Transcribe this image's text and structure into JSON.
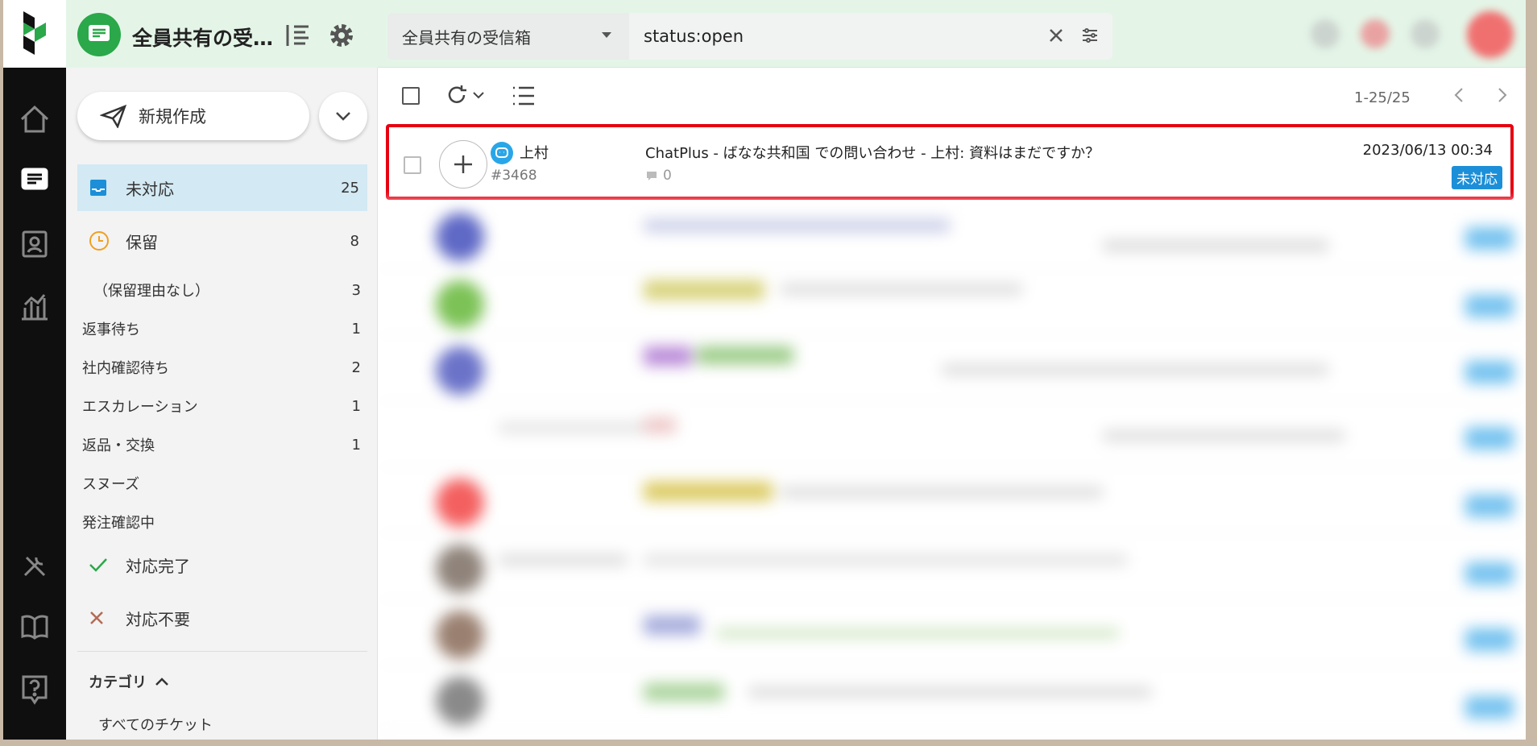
{
  "header": {
    "inbox_title": "全員共有の受…"
  },
  "sidebar": {
    "compose_label": "新規作成",
    "status_items": [
      {
        "label": "未対応",
        "count": "25"
      },
      {
        "label": "保留",
        "count": "8"
      }
    ],
    "sub_items": [
      {
        "label": "（保留理由なし）",
        "count": "3"
      },
      {
        "label": "返事待ち",
        "count": "1"
      },
      {
        "label": "社内確認待ち",
        "count": "2"
      },
      {
        "label": "エスカレーション",
        "count": "1"
      },
      {
        "label": "返品・交換",
        "count": "1"
      },
      {
        "label": "スヌーズ",
        "count": ""
      },
      {
        "label": "発注確認中",
        "count": ""
      }
    ],
    "done_items": [
      {
        "label": "対応完了"
      },
      {
        "label": "対応不要"
      }
    ],
    "category_heading": "カテゴリ",
    "category_items": [
      {
        "label": "すべてのチケット"
      }
    ]
  },
  "topbar": {
    "folder_label": "全員共有の受信箱",
    "search_value": "status:open"
  },
  "toolbar": {
    "pager": "1-25/25"
  },
  "tickets": [
    {
      "assignee": "上村",
      "ticket_no": "#3468",
      "subject": "ChatPlus - ばなな共和国 での問い合わせ  - 上村: 資料はまだですか？",
      "comment_count": "0",
      "datetime": "2023/06/13 00:34",
      "status": "未対応"
    }
  ],
  "colors": {
    "accent_green": "#2aa84a",
    "status_blue": "#1c8fd8",
    "highlight_red": "#e60012",
    "active_nav_bg": "#d3e9f3"
  },
  "icons": {
    "rail": [
      "home-icon",
      "inbox-icon",
      "contacts-icon",
      "reports-icon",
      "tools-icon",
      "book-icon",
      "help-icon"
    ]
  }
}
